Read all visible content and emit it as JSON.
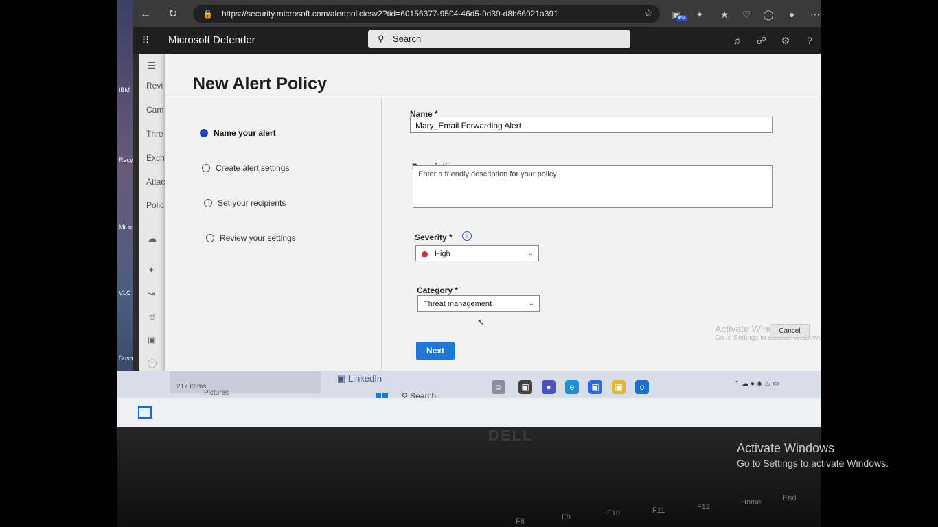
{
  "browser": {
    "url": "https://security.microsoft.com/alertpoliciesv2?tid=60156377-9504-46d5-9d39-d8b66921a391",
    "badge_count": "454"
  },
  "suite": {
    "app_title": "Microsoft Defender",
    "search_placeholder": "Search"
  },
  "desktop": {
    "icons": [
      "IBM",
      "Recycle Bin",
      "Microsoft Edge",
      "VLC media player",
      "Suspicious"
    ]
  },
  "leftnav": {
    "items": [
      "Revi",
      "Cam",
      "Thre",
      "Exch",
      "Attac",
      "Polic"
    ]
  },
  "panel": {
    "title": "New Alert Policy",
    "steps": [
      {
        "label": "Name your alert",
        "state": "current"
      },
      {
        "label": "Create alert settings",
        "state": "pending"
      },
      {
        "label": "Set your recipients",
        "state": "pending"
      },
      {
        "label": "Review your settings",
        "state": "pending"
      }
    ],
    "name_label": "Name *",
    "name_value": "Mary_Email Forwarding Alert",
    "description_label": "Description",
    "description_placeholder": "Enter a friendly description for your policy",
    "severity_label": "Severity *",
    "severity_value": "High",
    "severity_color": "#d13438",
    "category_label": "Category *",
    "category_value": "Threat management",
    "next_label": "Next",
    "cancel_label": "Cancel",
    "accent_color": "#1e78d4"
  },
  "taskbar": {
    "explorer_status": "217 items",
    "explorer_item": "Pictures",
    "linkedin": "LinkedIn",
    "search": "Search"
  },
  "inner_watermark": {
    "line1": "Activate Windows",
    "line2": "Go to Settings to activate Windows."
  },
  "keyboard": [
    "F8",
    "F9",
    "F10",
    "F11",
    "F12",
    "Home",
    "End"
  ],
  "laptop_brand": "DELL",
  "watermark": {
    "line1": "Activate Windows",
    "line2": "Go to Settings to activate Windows."
  }
}
